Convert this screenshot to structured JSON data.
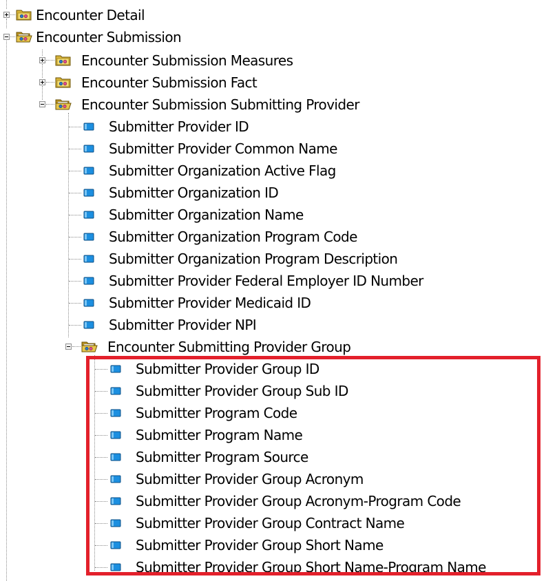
{
  "highlight_color": "#e3202b",
  "icons": {
    "folder": "folder-icon",
    "attribute": "attribute-icon",
    "expand": "expand-plus-icon",
    "collapse": "collapse-minus-icon"
  },
  "tree": {
    "items": [
      {
        "label": "Encounter Detail",
        "type": "folder",
        "expanded": false
      },
      {
        "label": "Encounter Submission",
        "type": "folder",
        "expanded": true
      },
      {
        "label": "Encounter Submission Measures",
        "type": "folder",
        "expanded": false
      },
      {
        "label": "Encounter Submission Fact",
        "type": "folder",
        "expanded": false
      },
      {
        "label": "Encounter Submission Submitting Provider",
        "type": "folder",
        "expanded": true
      },
      {
        "label": "Submitter Provider ID",
        "type": "attribute"
      },
      {
        "label": "Submitter Provider Common Name",
        "type": "attribute"
      },
      {
        "label": "Submitter Organization Active Flag",
        "type": "attribute"
      },
      {
        "label": "Submitter Organization ID",
        "type": "attribute"
      },
      {
        "label": "Submitter Organization Name",
        "type": "attribute"
      },
      {
        "label": "Submitter Organization Program Code",
        "type": "attribute"
      },
      {
        "label": "Submitter Organization Program Description",
        "type": "attribute"
      },
      {
        "label": "Submitter Provider Federal Employer ID Number",
        "type": "attribute"
      },
      {
        "label": "Submitter Provider Medicaid ID",
        "type": "attribute"
      },
      {
        "label": "Submitter Provider NPI",
        "type": "attribute"
      },
      {
        "label": "Encounter Submitting Provider Group",
        "type": "folder",
        "expanded": true
      },
      {
        "label": "Submitter Provider Group ID",
        "type": "attribute"
      },
      {
        "label": "Submitter Provider Group Sub ID",
        "type": "attribute"
      },
      {
        "label": "Submitter Program Code",
        "type": "attribute"
      },
      {
        "label": "Submitter Program Name",
        "type": "attribute"
      },
      {
        "label": "Submitter Program Source",
        "type": "attribute"
      },
      {
        "label": "Submitter Provider Group Acronym",
        "type": "attribute"
      },
      {
        "label": "Submitter Provider Group Acronym-Program Code",
        "type": "attribute"
      },
      {
        "label": "Submitter Provider Group Contract Name",
        "type": "attribute"
      },
      {
        "label": "Submitter Provider Group Short Name",
        "type": "attribute"
      },
      {
        "label": "Submitter Provider Group Short Name-Program Name",
        "type": "attribute"
      }
    ]
  }
}
